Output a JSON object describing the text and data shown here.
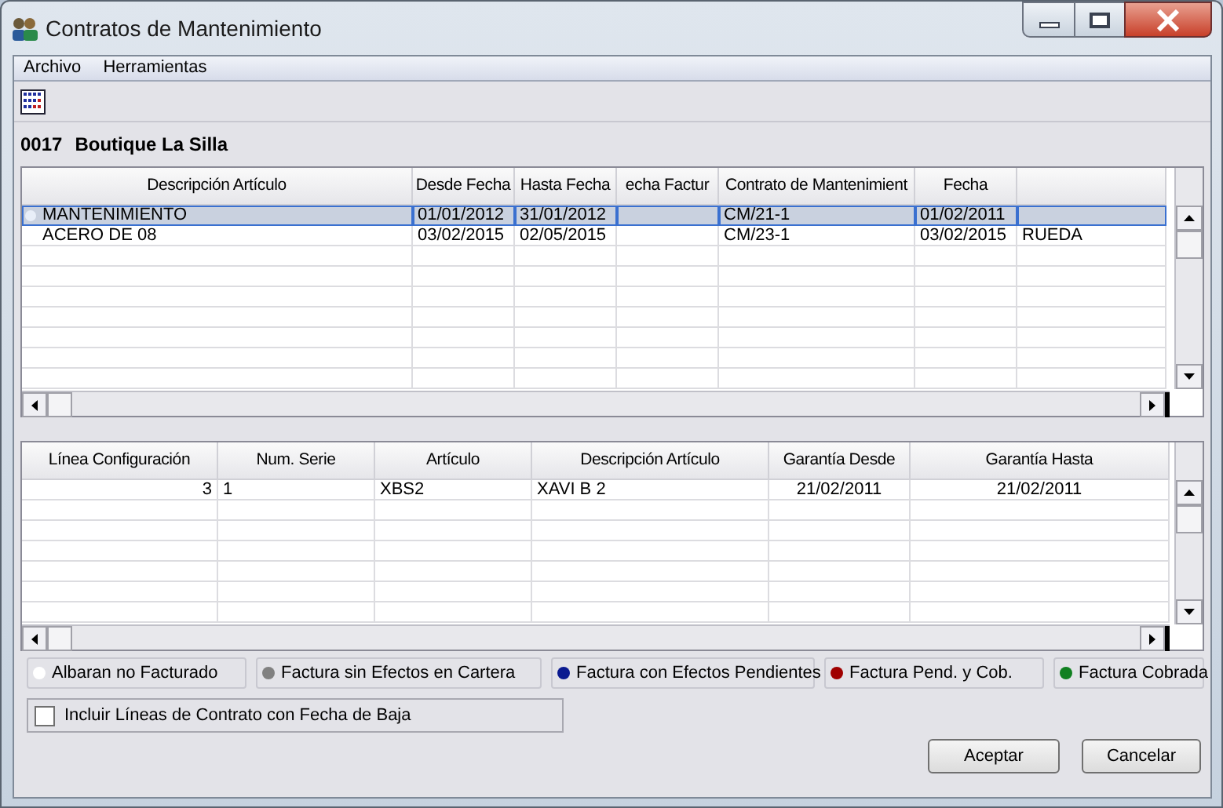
{
  "window": {
    "title": "Contratos de Mantenimiento"
  },
  "menu": [
    "Archivo",
    "Herramientas"
  ],
  "header": {
    "code": "0017",
    "name": "Boutique La Silla"
  },
  "top_grid": {
    "columns": [
      "Descripción Artículo",
      "Desde Fecha",
      "Hasta Fecha",
      "echa Factur",
      "Contrato de Mantenimient",
      "Fecha"
    ],
    "rows": [
      {
        "selected": true,
        "descripcion": "MANTENIMIENTO",
        "desde": "01/01/2012",
        "hasta": "31/01/2012",
        "contrato": "CM/21-1",
        "fecha": "01/02/2011"
      },
      {
        "selected": false,
        "descripcion": "ACERO DE 08",
        "desde": "03/02/2015",
        "hasta": "02/05/2015",
        "contrato": "CM/23-1",
        "fecha": "03/02/2015",
        "column_7": "RUEDA"
      }
    ]
  },
  "bottom_grid": {
    "columns": [
      "Línea Configuración",
      "Num. Serie",
      "Artículo",
      "Descripción Artículo",
      "Garantía Desde",
      "Garantía Hasta"
    ],
    "rows": [
      {
        "linea": "3",
        "serie": "1",
        "articulo": "XBS2",
        "descripcion": "XAVI B 2",
        "garantia_desde": "21/02/2011",
        "garantia_hasta": "21/02/2011"
      }
    ]
  },
  "legend": [
    {
      "label": "Albaran no Facturado",
      "color": "#ffffff"
    },
    {
      "label": "Factura sin Efectos en Cartera",
      "color": "#808080"
    },
    {
      "label": "Factura con Efectos Pendientes",
      "color": "#0a1a90"
    },
    {
      "label": "Factura Pend. y Cob.",
      "color": "#a00000"
    },
    {
      "label": "Factura Cobrada",
      "color": "#108020"
    }
  ],
  "include_checkbox": {
    "label": "Incluir Líneas de Contrato con Fecha de Baja",
    "checked": false
  },
  "buttons": [
    "Aceptar",
    "Cancelar"
  ]
}
